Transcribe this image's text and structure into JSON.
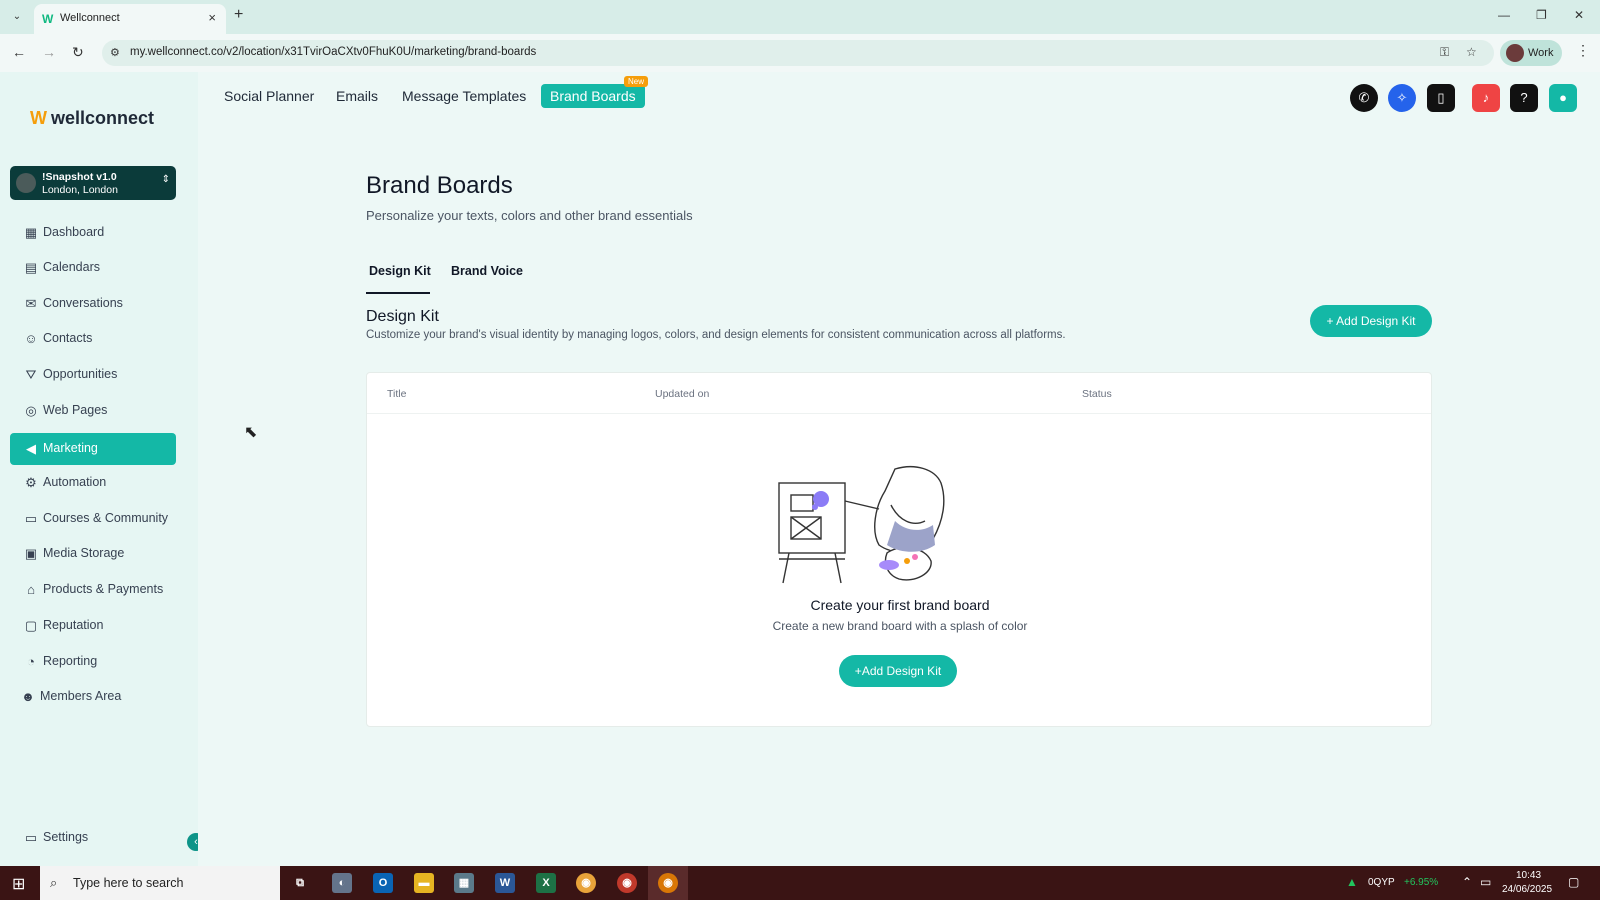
{
  "browser": {
    "tab_title": "Wellconnect",
    "url": "my.wellconnect.co/v2/location/x31TvirOaCXtv0FhuK0U/marketing/brand-boards",
    "profile_name": "Work"
  },
  "app": {
    "brand_name": "wellconnect",
    "location": {
      "name": "!Snapshot v1.0",
      "city": "London, London"
    },
    "sidebar": {
      "items": [
        {
          "label": "Dashboard",
          "icon": "dashboard-icon"
        },
        {
          "label": "Calendars",
          "icon": "calendar-icon"
        },
        {
          "label": "Conversations",
          "icon": "inbox-icon"
        },
        {
          "label": "Contacts",
          "icon": "user-icon"
        },
        {
          "label": "Opportunities",
          "icon": "filter-icon"
        },
        {
          "label": "Web Pages",
          "icon": "globe-icon"
        },
        {
          "label": "Marketing",
          "icon": "megaphone-icon",
          "active": true
        },
        {
          "label": "Automation",
          "icon": "robot-icon"
        },
        {
          "label": "Courses & Community",
          "icon": "monitor-icon"
        },
        {
          "label": "Media Storage",
          "icon": "file-image-icon"
        },
        {
          "label": "Products & Payments",
          "icon": "store-icon"
        },
        {
          "label": "Reputation",
          "icon": "review-icon"
        },
        {
          "label": "Reporting",
          "icon": "chart-icon"
        },
        {
          "label": "Members Area",
          "icon": "users-icon"
        }
      ],
      "settings_label": "Settings"
    },
    "topnav": {
      "items": [
        "Social Planner",
        "Emails",
        "Message Templates",
        "Brand Boards"
      ],
      "active": "Brand Boards",
      "new_badge": "New"
    },
    "page": {
      "title": "Brand Boards",
      "subtitle": "Personalize your texts, colors and other brand essentials",
      "tabs": [
        "Design Kit",
        "Brand Voice"
      ],
      "active_tab": "Design Kit",
      "section_title": "Design Kit",
      "section_desc": "Customize your brand's visual identity by managing logos, colors, and design elements for consistent communication across all platforms.",
      "add_button_label": "Add Design Kit",
      "table_headers": [
        "Title",
        "Updated on",
        "Status"
      ],
      "empty_title": "Create your first brand board",
      "empty_sub": "Create a new brand board with a splash of color",
      "empty_button_label": "Add Design Kit"
    }
  },
  "taskbar": {
    "search_placeholder": "Type here to search",
    "ticker": "0QYP",
    "ticker_change": "+6.95%",
    "time": "10:43",
    "date": "24/06/2025"
  },
  "colors": {
    "accent": "#14b8a6",
    "sidebar_bg": "#e6f6f3",
    "main_bg": "#edf8f6",
    "taskbar_bg": "#3a1414"
  }
}
